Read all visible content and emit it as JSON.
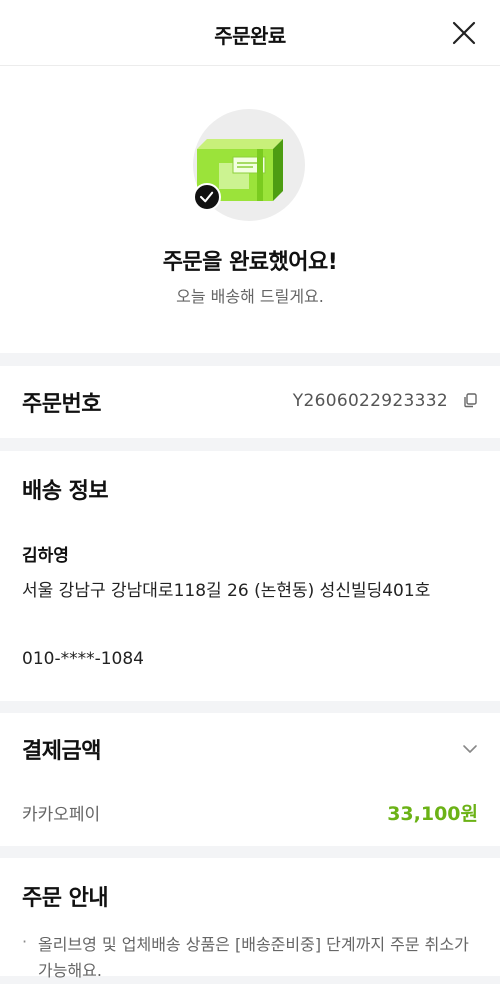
{
  "header": {
    "title": "주문완료",
    "close_icon": "close-icon"
  },
  "hero": {
    "title": "주문을 완료했어요!",
    "subtitle": "오늘 배송해 드릴게요.",
    "illustration_icon": "package-box-icon",
    "badge_icon": "check-icon"
  },
  "order": {
    "label": "주문번호",
    "number": "Y2606022923332",
    "copy_icon": "copy-icon"
  },
  "shipping": {
    "label": "배송 정보",
    "name": "김하영",
    "address": "서울 강남구 강남대로118길 26 (논현동) 성신빌딩401호",
    "phone": "010-****-1084"
  },
  "payment": {
    "label": "결제금액",
    "method": "카카오페이",
    "amount": "33,100원",
    "expand_icon": "chevron-down-icon"
  },
  "guide": {
    "label": "주문 안내",
    "bullet": "·",
    "text": "올리브영 및 업체배송 상품은 [배송준비중] 단계까지 주문 취소가 가능해요."
  },
  "colors": {
    "accent_green": "#6bb216",
    "background": "#f3f4f6"
  }
}
